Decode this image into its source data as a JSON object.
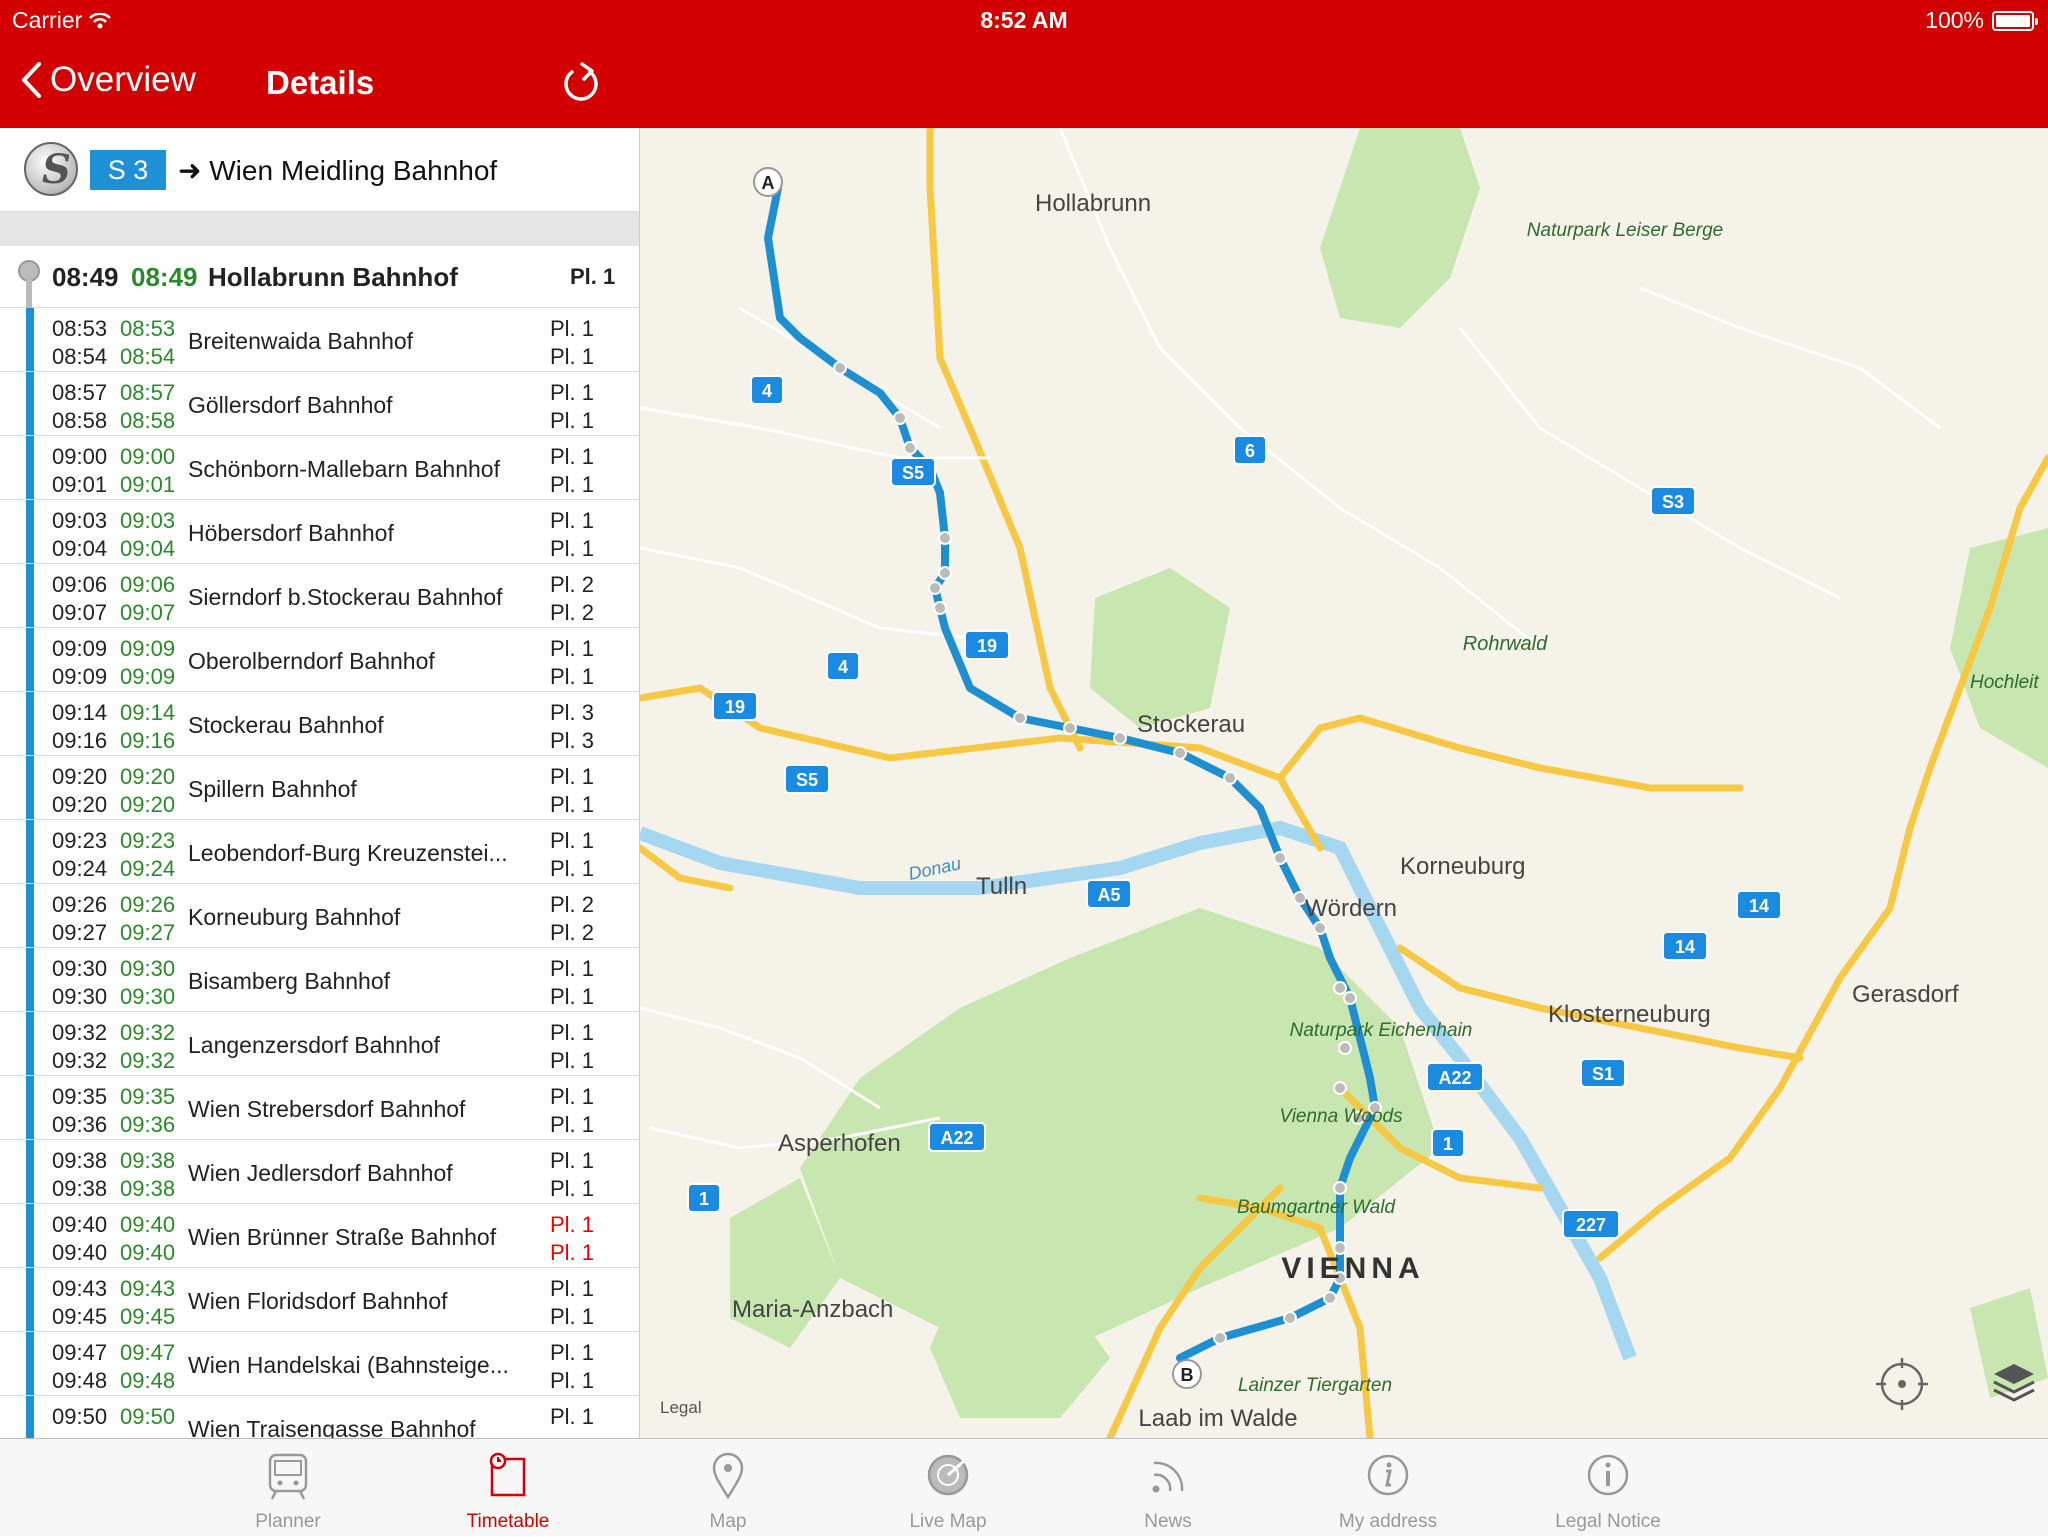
{
  "status": {
    "carrier": "Carrier",
    "time": "8:52 AM",
    "battery": "100%"
  },
  "nav": {
    "back_label": "Overview",
    "title": "Details"
  },
  "line": {
    "badge": "S 3",
    "destination": "Wien Meidling Bahnhof"
  },
  "first_stop": {
    "time": "08:49",
    "realtime": "08:49",
    "station": "Hollabrunn Bahnhof",
    "platform": "Pl. 1"
  },
  "stops": [
    {
      "arr": "08:53",
      "arr_rt": "08:53",
      "dep": "08:54",
      "dep_rt": "08:54",
      "station": "Breitenwaida Bahnhof",
      "pl_arr": "Pl. 1",
      "pl_dep": "Pl. 1",
      "pl_changed": false
    },
    {
      "arr": "08:57",
      "arr_rt": "08:57",
      "dep": "08:58",
      "dep_rt": "08:58",
      "station": "Göllersdorf Bahnhof",
      "pl_arr": "Pl. 1",
      "pl_dep": "Pl. 1",
      "pl_changed": false
    },
    {
      "arr": "09:00",
      "arr_rt": "09:00",
      "dep": "09:01",
      "dep_rt": "09:01",
      "station": "Schönborn-Mallebarn Bahnhof",
      "pl_arr": "Pl. 1",
      "pl_dep": "Pl. 1",
      "pl_changed": false
    },
    {
      "arr": "09:03",
      "arr_rt": "09:03",
      "dep": "09:04",
      "dep_rt": "09:04",
      "station": "Höbersdorf Bahnhof",
      "pl_arr": "Pl. 1",
      "pl_dep": "Pl. 1",
      "pl_changed": false
    },
    {
      "arr": "09:06",
      "arr_rt": "09:06",
      "dep": "09:07",
      "dep_rt": "09:07",
      "station": "Sierndorf b.Stockerau Bahnhof",
      "pl_arr": "Pl. 2",
      "pl_dep": "Pl. 2",
      "pl_changed": false
    },
    {
      "arr": "09:09",
      "arr_rt": "09:09",
      "dep": "09:09",
      "dep_rt": "09:09",
      "station": "Oberolberndorf Bahnhof",
      "pl_arr": "Pl. 1",
      "pl_dep": "Pl. 1",
      "pl_changed": false
    },
    {
      "arr": "09:14",
      "arr_rt": "09:14",
      "dep": "09:16",
      "dep_rt": "09:16",
      "station": "Stockerau Bahnhof",
      "pl_arr": "Pl. 3",
      "pl_dep": "Pl. 3",
      "pl_changed": false
    },
    {
      "arr": "09:20",
      "arr_rt": "09:20",
      "dep": "09:20",
      "dep_rt": "09:20",
      "station": "Spillern Bahnhof",
      "pl_arr": "Pl. 1",
      "pl_dep": "Pl. 1",
      "pl_changed": false
    },
    {
      "arr": "09:23",
      "arr_rt": "09:23",
      "dep": "09:24",
      "dep_rt": "09:24",
      "station": "Leobendorf-Burg Kreuzenstei...",
      "pl_arr": "Pl. 1",
      "pl_dep": "Pl. 1",
      "pl_changed": false
    },
    {
      "arr": "09:26",
      "arr_rt": "09:26",
      "dep": "09:27",
      "dep_rt": "09:27",
      "station": "Korneuburg Bahnhof",
      "pl_arr": "Pl. 2",
      "pl_dep": "Pl. 2",
      "pl_changed": false
    },
    {
      "arr": "09:30",
      "arr_rt": "09:30",
      "dep": "09:30",
      "dep_rt": "09:30",
      "station": "Bisamberg Bahnhof",
      "pl_arr": "Pl. 1",
      "pl_dep": "Pl. 1",
      "pl_changed": false
    },
    {
      "arr": "09:32",
      "arr_rt": "09:32",
      "dep": "09:32",
      "dep_rt": "09:32",
      "station": "Langenzersdorf Bahnhof",
      "pl_arr": "Pl. 1",
      "pl_dep": "Pl. 1",
      "pl_changed": false
    },
    {
      "arr": "09:35",
      "arr_rt": "09:35",
      "dep": "09:36",
      "dep_rt": "09:36",
      "station": "Wien Strebersdorf Bahnhof",
      "pl_arr": "Pl. 1",
      "pl_dep": "Pl. 1",
      "pl_changed": false
    },
    {
      "arr": "09:38",
      "arr_rt": "09:38",
      "dep": "09:38",
      "dep_rt": "09:38",
      "station": "Wien Jedlersdorf Bahnhof",
      "pl_arr": "Pl. 1",
      "pl_dep": "Pl. 1",
      "pl_changed": false
    },
    {
      "arr": "09:40",
      "arr_rt": "09:40",
      "dep": "09:40",
      "dep_rt": "09:40",
      "station": "Wien Brünner Straße Bahnhof",
      "pl_arr": "Pl. 1",
      "pl_dep": "Pl. 1",
      "pl_changed": true
    },
    {
      "arr": "09:43",
      "arr_rt": "09:43",
      "dep": "09:45",
      "dep_rt": "09:45",
      "station": "Wien Floridsdorf Bahnhof",
      "pl_arr": "Pl. 1",
      "pl_dep": "Pl. 1",
      "pl_changed": false
    },
    {
      "arr": "09:47",
      "arr_rt": "09:47",
      "dep": "09:48",
      "dep_rt": "09:48",
      "station": "Wien Handelskai (Bahnsteige...",
      "pl_arr": "Pl. 1",
      "pl_dep": "Pl. 1",
      "pl_changed": false
    },
    {
      "arr": "09:50",
      "arr_rt": "09:50",
      "dep": "",
      "dep_rt": "",
      "station": "Wien Traisengasse Bahnhof",
      "pl_arr": "Pl. 1",
      "pl_dep": "",
      "pl_changed": false
    }
  ],
  "map": {
    "places": [
      "Hollabrunn",
      "Naturpark Leiser Berge",
      "Rohrwald",
      "Hochleit",
      "Stockerau",
      "Korneuburg",
      "Wördern",
      "Tulln",
      "Klosterneuburg",
      "Gerasdorf",
      "Naturpark Eichenhain",
      "Vienna Woods",
      "Asperhofen",
      "Baumgartner Wald",
      "VIENNA",
      "Maria-Anzbach",
      "Lainzer Tiergarten",
      "Laab im Walde"
    ],
    "river": "Donau",
    "shields": [
      "4",
      "4",
      "6",
      "19",
      "19",
      "S5",
      "S5",
      "S3",
      "A5",
      "14",
      "14",
      "S1",
      "A22",
      "A22",
      "1",
      "1",
      "227"
    ],
    "marker_start": "A",
    "marker_end": "B",
    "legal": "Legal"
  },
  "tabs": [
    {
      "label": "Planner",
      "icon": "train-icon"
    },
    {
      "label": "Timetable",
      "icon": "timetable-icon"
    },
    {
      "label": "Map",
      "icon": "map-pin-icon"
    },
    {
      "label": "Live Map",
      "icon": "live-map-icon"
    },
    {
      "label": "News",
      "icon": "news-rss-icon"
    },
    {
      "label": "My address",
      "icon": "info-icon"
    },
    {
      "label": "Legal Notice",
      "icon": "legal-info-icon"
    }
  ],
  "active_tab": "Timetable",
  "colors": {
    "brand": "#d30000",
    "line": "#1e90d6",
    "realtime": "#2a8a2a",
    "changed": "#e00000"
  }
}
